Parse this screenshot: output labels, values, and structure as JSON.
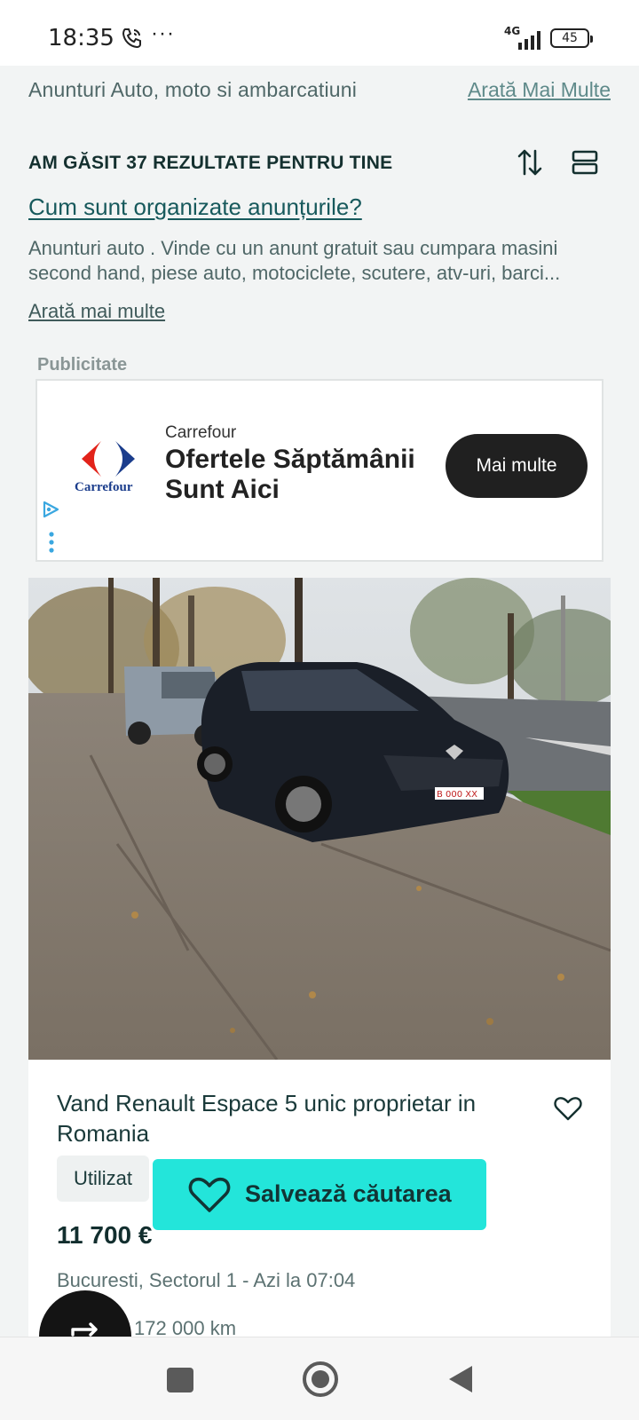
{
  "status_bar": {
    "time": "18:35",
    "dots": "···",
    "network": "4G",
    "battery": "45"
  },
  "header": {
    "category_crumb": "Anunturi Auto, moto si ambarcatiuni",
    "show_more": "Arată Mai Multe"
  },
  "results": {
    "title": "AM GĂSIT 37 REZULTATE PENTRU TINE",
    "faq_link": "Cum sunt organizate anunțurile?",
    "description": "Anunturi auto . Vinde cu un anunt gratuit sau cumpara masini second hand, piese auto, motociclete, scutere, atv-uri, barci...",
    "show_more": "Arată mai multe"
  },
  "ad": {
    "label": "Publicitate",
    "brand": "Carrefour",
    "logo_text": "Carrefour",
    "headline": "Ofertele Săptămânii Sunt Aici",
    "button": "Mai multe"
  },
  "listing": {
    "title": "Vand Renault Espace 5 unic proprietar in Romania",
    "condition": "Utilizat",
    "price": "11 700 €",
    "location": "Bucuresti, Sectorul 1 - Azi la 07:04",
    "specs": "2016 172 000 km",
    "plate": "B 000 XX"
  },
  "save_search": {
    "label": "Salvează căutarea"
  },
  "colors": {
    "accent": "#23e5da",
    "page_bg": "#f2f4f4",
    "text_dark": "#14302f"
  }
}
